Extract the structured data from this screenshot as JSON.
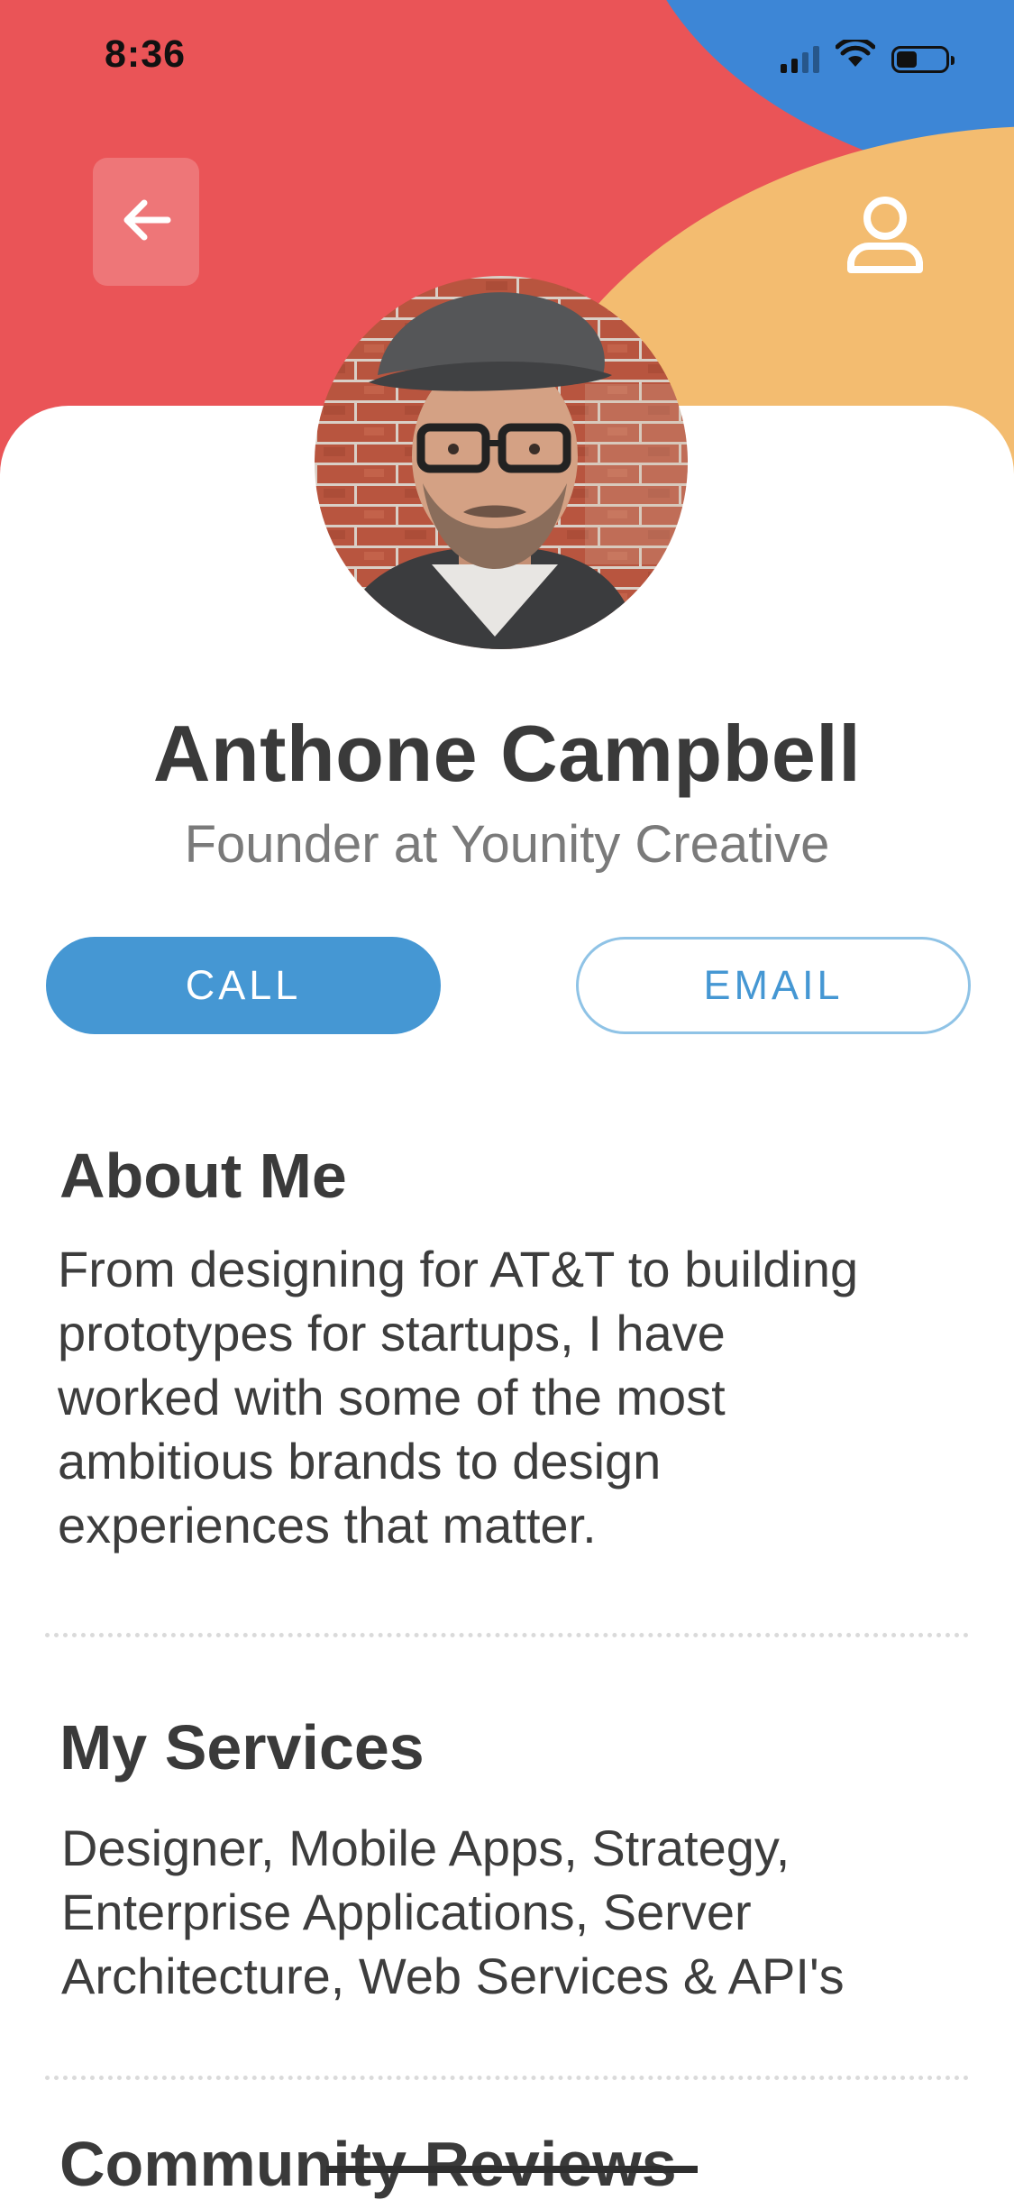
{
  "status_bar": {
    "time": "8:36",
    "icons": [
      "signal-icon",
      "wifi-icon",
      "battery-icon"
    ]
  },
  "header": {
    "back_icon": "arrow-left-icon",
    "profile_icon": "user-icon",
    "colors": {
      "red": "#ea5457",
      "blue": "#3d86d6",
      "orange": "#f3bc70"
    }
  },
  "profile": {
    "name": "Anthone Campbell",
    "title": "Founder at Younity Creative"
  },
  "actions": {
    "call_label": "CALL",
    "email_label": "EMAIL",
    "accent_color": "#4597d3"
  },
  "about": {
    "heading": "About Me",
    "lines": [
      "From designing for AT&T to building",
      "prototypes for startups, I have",
      "worked with some of the most",
      "ambitious brands to design",
      "experiences that matter."
    ]
  },
  "services": {
    "heading": "My Services",
    "lines": [
      "Designer, Mobile Apps, Strategy,",
      "Enterprise Applications, Server",
      "Architecture, Web Services & API's"
    ]
  },
  "reviews": {
    "heading": "Community Reviews"
  }
}
